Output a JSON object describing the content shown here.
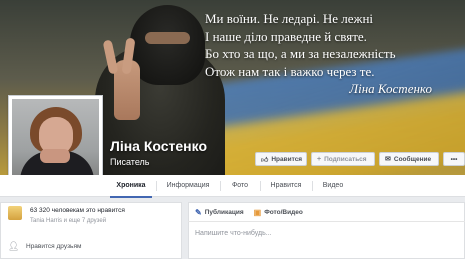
{
  "cover": {
    "quote_lines": [
      "Ми воїни. Не ледарі. Не лежні",
      "І наше діло праведне й святе.",
      "Бо хто за що, а ми за незалежність",
      "Отож нам так і важко через те."
    ],
    "quote_author": "Ліна Костенко"
  },
  "profile": {
    "name": "Ліна Костенко",
    "category": "Писатель"
  },
  "actions": {
    "like_label": "Нравится",
    "subscribe_label": "Подписаться",
    "message_label": "Сообщение",
    "more_label": "•••"
  },
  "tabs": [
    {
      "label": "Хроника"
    },
    {
      "label": "Информация"
    },
    {
      "label": "Фото"
    },
    {
      "label": "Нравится"
    },
    {
      "label": "Видео"
    }
  ],
  "sidebar": {
    "likes_count": "63 320 человекам это нравится",
    "likes_friends": "Tania Harris и еще 7 друзей",
    "friends_liked": "Нравится друзьям"
  },
  "composer": {
    "publication_label": "Публикация",
    "photo_video_label": "Фото/Видео",
    "input_placeholder": "Напишите что-нибудь..."
  },
  "colors": {
    "accent": "#4267b2",
    "background": "#e9ebee"
  }
}
